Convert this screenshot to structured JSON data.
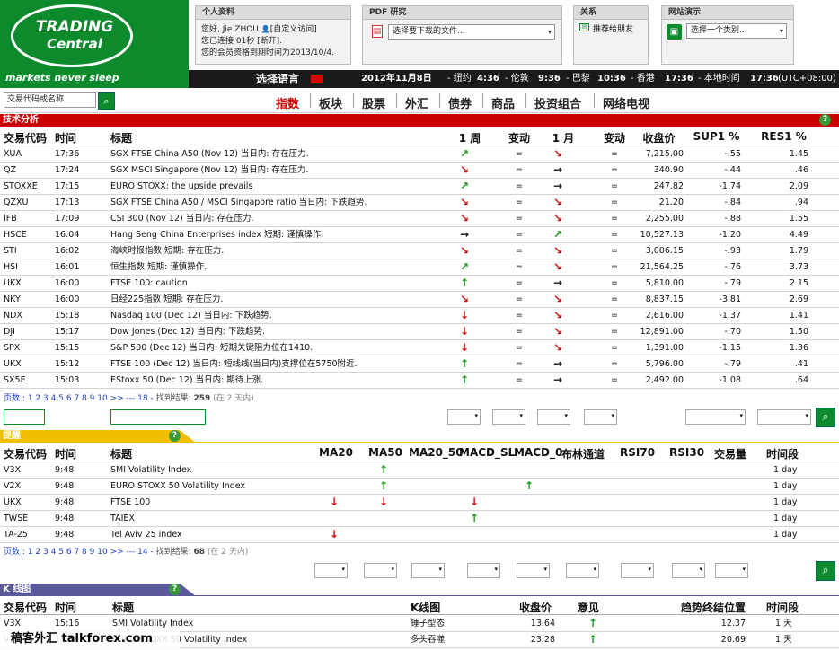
{
  "logo": {
    "line1": "TRADING",
    "line2": "Central",
    "tagline": "markets never sleep"
  },
  "profile": {
    "title": "个人资料",
    "l1": "您好, Jie ZHOU",
    "l1b": "[自定义访问]",
    "l2": "您已连接 01秒 [断开].",
    "l3": "您的会员资格到期时间为2013/10/4."
  },
  "pdf": {
    "title": "PDF 研究",
    "select": "选择要下载的文件..."
  },
  "relation": {
    "title": "关系",
    "link": "推荐给朋友"
  },
  "demo": {
    "title": "网站演示",
    "select": "选择一个类别..."
  },
  "bar": {
    "lang": "选择语言",
    "date": "2012年11月8日",
    "t1": "- 纽约",
    "v1": "4:36",
    "t2": "- 伦敦",
    "v2": "9:36",
    "t3": "- 巴黎",
    "v3": "10:36",
    "t4": "- 香港",
    "v4": "17:36",
    "t5": "- 本地时间",
    "v5": "17:36",
    "tz": "(UTC+08:00)"
  },
  "search": {
    "placeholder": "交易代码或名称"
  },
  "nav": [
    "指数",
    "板块",
    "股票",
    "外汇",
    "债券",
    "商品",
    "投资组合",
    "网络电视"
  ],
  "ta": {
    "title": "技术分析",
    "cols": [
      "交易代码",
      "时间",
      "标题",
      "1 周",
      "变动",
      "1 月",
      "变动",
      "收盘价",
      "SUP1 %",
      "RES1 %"
    ],
    "rows": [
      [
        "XUA",
        "17:36",
        "SGX FTSE China A50  (Nov 12) 当日内: 存在压力.",
        "ur",
        "=",
        "dr",
        "=",
        "7,215.00",
        "-.55",
        "1.45"
      ],
      [
        "QZ",
        "17:24",
        "SGX MSCI Singapore (Nov 12) 当日内: 存在压力.",
        "dr",
        "=",
        "rt",
        "=",
        "340.90",
        "-.44",
        ".46"
      ],
      [
        "STOXXE",
        "17:15",
        "EURO STOXX: the upside prevails",
        "ur",
        "=",
        "rt",
        "=",
        "247.82",
        "-1.74",
        "2.09"
      ],
      [
        "QZXU",
        "17:13",
        "SGX FTSE China A50 / MSCI Singapore ratio 当日内: 下跌趋势.",
        "dr",
        "=",
        "dr",
        "=",
        "21.20",
        "-.84",
        ".94"
      ],
      [
        "IFB",
        "17:09",
        "CSI 300 (Nov 12) 当日内: 存在压力.",
        "dr",
        "=",
        "dr",
        "=",
        "2,255.00",
        "-.88",
        "1.55"
      ],
      [
        "HSCE",
        "16:04",
        "Hang Seng China Enterprises index 短期: 谨慎操作.",
        "rt",
        "=",
        "ur",
        "=",
        "10,527.13",
        "-1.20",
        "4.49"
      ],
      [
        "STI",
        "16:02",
        "海峡时报指数  短期: 存在压力.",
        "dr",
        "=",
        "dr",
        "=",
        "3,006.15",
        "-.93",
        "1.79"
      ],
      [
        "HSI",
        "16:01",
        "恒生指数  短期: 谨慎操作.",
        "ur",
        "=",
        "dr",
        "=",
        "21,564.25",
        "-.76",
        "3.73"
      ],
      [
        "UKX",
        "16:00",
        "FTSE 100: caution",
        "up",
        "=",
        "rt",
        "=",
        "5,810.00",
        "-.79",
        "2.15"
      ],
      [
        "NKY",
        "16:00",
        "日经225指数  短期: 存在压力.",
        "dr",
        "=",
        "dr",
        "=",
        "8,837.15",
        "-3.81",
        "2.69"
      ],
      [
        "NDX",
        "15:18",
        "Nasdaq 100 (Dec 12) 当日内: 下跌趋势.",
        "dn",
        "=",
        "dr",
        "=",
        "2,616.00",
        "-1.37",
        "1.41"
      ],
      [
        "DJI",
        "15:17",
        "Dow Jones (Dec 12) 当日内: 下跌趋势.",
        "dn",
        "=",
        "dr",
        "=",
        "12,891.00",
        "-.70",
        "1.50"
      ],
      [
        "SPX",
        "15:15",
        "S&P 500 (Dec 12) 当日内: 短期关键阻力位在1410.",
        "dn",
        "=",
        "dr",
        "=",
        "1,391.00",
        "-1.15",
        "1.36"
      ],
      [
        "UKX",
        "15:12",
        "FTSE 100 (Dec 12) 当日内: 短线线(当日内)支撑位在5750附近.",
        "up",
        "=",
        "rt",
        "=",
        "5,796.00",
        "-.79",
        ".41"
      ],
      [
        "SX5E",
        "15:03",
        "EStoxx 50 (Dec 12) 当日内: 期待上涨.",
        "up",
        "=",
        "rt",
        "=",
        "2,492.00",
        "-1.08",
        ".64"
      ]
    ],
    "pager": {
      "label": "页数 :",
      "pages": [
        "1",
        "2",
        "3",
        "4",
        "5",
        "6",
        "7",
        "8",
        "9",
        "10"
      ],
      "more": ">> --- 18 -",
      "found": "找到结果:",
      "count": "259",
      "days": "(在 2 天内)"
    }
  },
  "alerts": {
    "title": "提醒",
    "cols": [
      "交易代码",
      "时间",
      "标题",
      "MA20",
      "MA50",
      "MA20_50",
      "MACD_SL",
      "MACD_0",
      "布林通道",
      "RSI70",
      "RSI30",
      "交易量",
      "时间段"
    ],
    "rows": [
      {
        "code": "V3X",
        "time": "9:48",
        "title": "SMI Volatility Index",
        "marks": {
          "MA50": "up"
        },
        "period": "1 day"
      },
      {
        "code": "V2X",
        "time": "9:48",
        "title": "EURO STOXX 50 Volatility Index",
        "marks": {
          "MA50": "up",
          "MACD_0": "up"
        },
        "period": "1 day"
      },
      {
        "code": "UKX",
        "time": "9:48",
        "title": "FTSE 100",
        "marks": {
          "MA20": "dn",
          "MA50": "dn",
          "MACD_SL": "dn"
        },
        "period": "1 day"
      },
      {
        "code": "TWSE",
        "time": "9:48",
        "title": "TAIEX",
        "marks": {
          "MACD_SL": "up"
        },
        "period": "1 day"
      },
      {
        "code": "TA-25",
        "time": "9:48",
        "title": "Tel Aviv 25 index",
        "marks": {
          "MA20": "dn"
        },
        "period": "1 day"
      }
    ],
    "pager": {
      "label": "页数 :",
      "pages": [
        "1",
        "2",
        "3",
        "4",
        "5",
        "6",
        "7",
        "8",
        "9",
        "10"
      ],
      "more": ">> --- 14 -",
      "found": "找到结果:",
      "count": "68",
      "days": "(在 2 天内)"
    }
  },
  "kline": {
    "title": "K 线图",
    "cols": [
      "交易代码",
      "时间",
      "标题",
      "K线图",
      "收盘价",
      "意见",
      "趋势终结位置",
      "时间段"
    ],
    "rows": [
      [
        "V3X",
        "15:16",
        "SMI Volatility Index",
        "锤子型态",
        "13.64",
        "up",
        "12.37",
        "1 天"
      ],
      [
        "V2X",
        "15:16",
        "EURO STOXX 50 Volatility Index",
        "多头吞噬",
        "23.28",
        "up",
        "20.69",
        "1 天"
      ]
    ]
  },
  "watermark": "稿客外汇 talkforex.com",
  "colors": {
    "green": "#0c8a2c",
    "red": "#cc0000",
    "yellow": "#f0c000",
    "purple": "#5a5a9a"
  },
  "glyphs": {
    "up": "↑",
    "dn": "↓",
    "rt": "→",
    "ur": "↗",
    "dr": "↘",
    "eq": "=",
    "go": "⌕",
    "help": "?",
    "select-arrow": "▾",
    "user": "👤",
    "pdf": "▤",
    "mail": "✉",
    "book": "▣"
  }
}
